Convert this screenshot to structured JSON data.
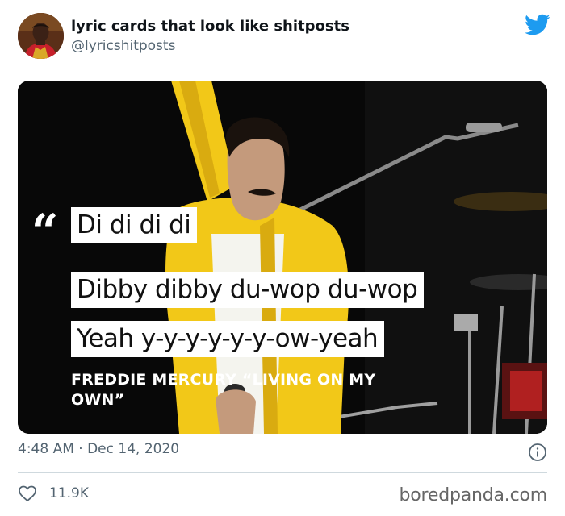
{
  "tweet": {
    "display_name": "lyric cards that look like shitposts",
    "handle": "@lyricshitposts",
    "timestamp": "4:48 AM · Dec 14, 2020",
    "likes": "11.9K"
  },
  "lyric_card": {
    "quote_mark": "“",
    "lines": [
      "Di di di di",
      "Dibby dibby du-wop du-wop",
      "Yeah y-y-y-y-y-y-ow-yeah"
    ],
    "attribution": "FREDDIE MERCURY “LIVING ON MY OWN”"
  },
  "watermark": "boredpanda.com",
  "icons": {
    "avatar": "avatar-image",
    "brand": "twitter-bird-icon",
    "info": "info-icon",
    "like": "heart-icon"
  },
  "colors": {
    "twitter_blue": "#1d9bf0",
    "secondary_text": "#536471",
    "jacket_yellow": "#f2c818"
  }
}
